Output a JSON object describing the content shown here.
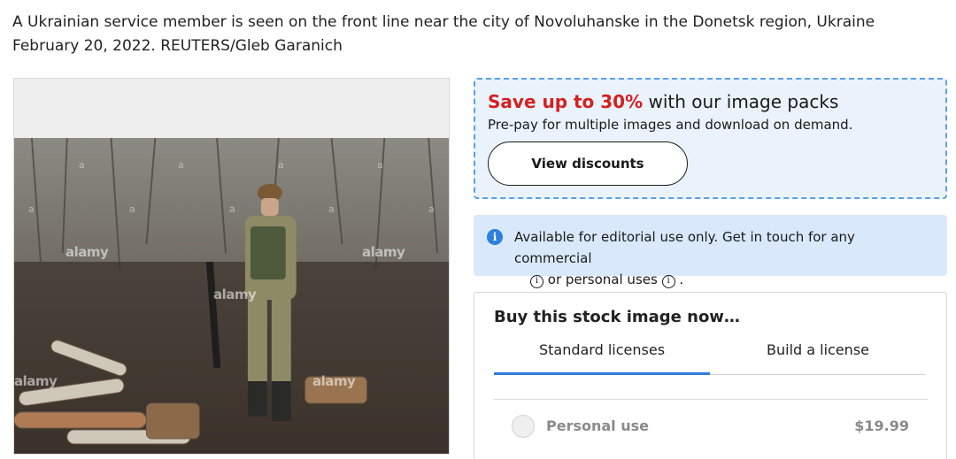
{
  "caption": "A Ukrainian service member is seen on the front line near the city of Novoluhanske in the Donetsk region, Ukraine February 20, 2022. REUTERS/Gleb Garanich",
  "image": {
    "watermarks": [
      "alamy",
      "alamy",
      "alamy",
      "alamy",
      "alamy"
    ],
    "watermark_small": "a"
  },
  "promo": {
    "highlight": "Save up to 30%",
    "headline_rest": " with our image packs",
    "subtext": "Pre-pay for multiple images and download on demand.",
    "button_label": "View discounts",
    "accent_color": "#d42020"
  },
  "info": {
    "icon": "info-icon",
    "line1": "Available for editorial use only. Get in touch for any commercial",
    "line2_part1": "or personal uses",
    "line2_part2": ".",
    "inline_icon_glyph": "i"
  },
  "buy": {
    "title": "Buy this stock image now…",
    "tabs": [
      {
        "label": "Standard licenses",
        "active": true
      },
      {
        "label": "Build a license",
        "active": false
      }
    ],
    "options": [
      {
        "label": "Personal use",
        "price": "$19.99"
      }
    ]
  }
}
